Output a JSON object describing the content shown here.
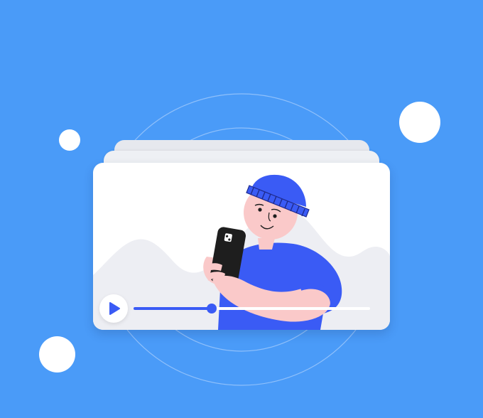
{
  "colors": {
    "background": "#4A9BF8",
    "accent": "#3A5BF5",
    "card": "#FFFFFF",
    "skin": "#FAC9C9",
    "phone": "#1E1E1E"
  },
  "video_player": {
    "progress": 0.33
  }
}
